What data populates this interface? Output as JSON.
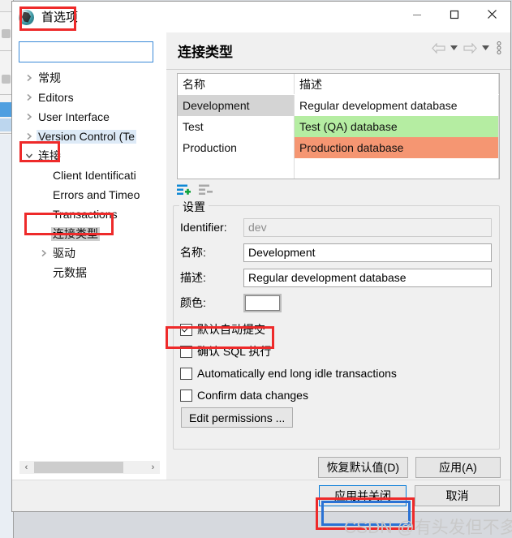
{
  "window": {
    "title": "首选项",
    "icon": "dbeaver-logo-icon",
    "minimize": "–",
    "maximize": "□",
    "close": "✕"
  },
  "search": {
    "value": "",
    "placeholder": ""
  },
  "tree": {
    "items": [
      {
        "label": "常规",
        "level": 0,
        "twisty": "collapsed",
        "highlight": "none"
      },
      {
        "label": "Editors",
        "level": 0,
        "twisty": "collapsed",
        "highlight": "none"
      },
      {
        "label": "User Interface",
        "level": 0,
        "twisty": "collapsed",
        "highlight": "none"
      },
      {
        "label": "Version Control (Te",
        "level": 0,
        "twisty": "collapsed",
        "highlight": "blue"
      },
      {
        "label": "连接",
        "level": 0,
        "twisty": "expanded",
        "highlight": "none"
      },
      {
        "label": "Client Identificati",
        "level": 1,
        "twisty": "none",
        "highlight": "none"
      },
      {
        "label": "Errors and Timeo",
        "level": 1,
        "twisty": "none",
        "highlight": "none"
      },
      {
        "label": "Transactions",
        "level": 1,
        "twisty": "none",
        "highlight": "none"
      },
      {
        "label": "连接类型",
        "level": 1,
        "twisty": "none",
        "highlight": "gray"
      },
      {
        "label": "驱动",
        "level": 1,
        "twisty": "collapsed",
        "highlight": "none"
      },
      {
        "label": "元数据",
        "level": 1,
        "twisty": "none",
        "highlight": "none"
      }
    ],
    "scroll_left_arrow": "‹",
    "scroll_right_arrow": "›"
  },
  "page": {
    "title": "连接类型",
    "nav": {
      "back": "back-arrow-icon",
      "back_menu": "dropdown-icon",
      "forward": "forward-arrow-icon",
      "forward_menu": "dropdown-icon",
      "menu": "view-menu-icon"
    }
  },
  "table": {
    "columns": [
      "名称",
      "描述"
    ],
    "rows": [
      {
        "name": "Development",
        "desc": "Regular development database",
        "name_style": "selected",
        "desc_style": "plain"
      },
      {
        "name": "Test",
        "desc": "Test (QA) database",
        "name_style": "plain",
        "desc_style": "green"
      },
      {
        "name": "Production",
        "desc": "Production database",
        "name_style": "plain",
        "desc_style": "orange"
      }
    ],
    "toolbar": {
      "add": "add-row-icon",
      "remove": "remove-row-icon"
    }
  },
  "settings": {
    "group_title": "设置",
    "fields": [
      {
        "label": "Identifier:",
        "value": "dev",
        "readonly": true
      },
      {
        "label": "名称:",
        "value": "Development",
        "readonly": false
      },
      {
        "label": "描述:",
        "value": "Regular development database",
        "readonly": false
      }
    ],
    "color": {
      "label": "颜色:",
      "value": "#ffffff"
    },
    "checkboxes": [
      {
        "label": "默认自动提交",
        "checked": true
      },
      {
        "label": "确认 SQL 执行",
        "checked": false
      },
      {
        "label": "Automatically end long idle transactions",
        "checked": false
      },
      {
        "label": "Confirm data changes",
        "checked": false
      }
    ],
    "edit_permissions": "Edit permissions ..."
  },
  "buttons": {
    "restore_defaults": "恢复默认值(D)",
    "apply": "应用(A)",
    "apply_and_close": "应用并关闭",
    "cancel": "取消"
  },
  "colors": {
    "accent": "#0078d7",
    "annotation": "#ee2a2a",
    "annotation_blue": "#2a72d4",
    "row_green": "#b5eda2",
    "row_orange": "#f59672",
    "row_selected": "#d4d4d4",
    "tree_highlight": "#ddeaf7"
  },
  "watermark": "CSDN @有头发但不多"
}
